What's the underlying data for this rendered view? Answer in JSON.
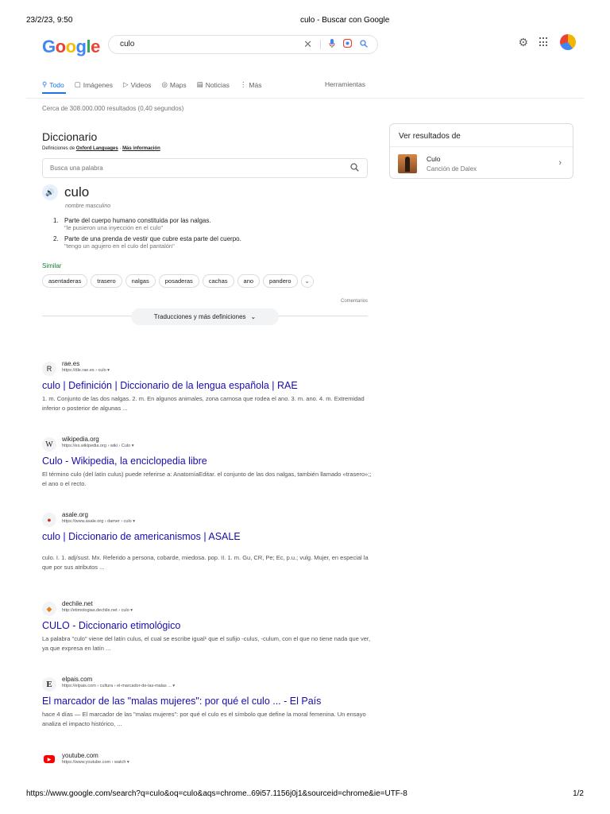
{
  "print": {
    "date": "23/2/23, 9:50",
    "title": "culo - Buscar con Google",
    "url": "https://www.google.com/search?q=culo&oq=culo&aqs=chrome..69i57.1156j0j1&sourceid=chrome&ie=UTF-8",
    "page": "1/2"
  },
  "colors": {
    "link": "#1a0dab",
    "accent": "#1a73e8",
    "similar": "#188038"
  },
  "header": {
    "logo": [
      "G",
      "o",
      "o",
      "g",
      "l",
      "e"
    ],
    "query": "culo",
    "icons": [
      "clear-icon",
      "mic-icon",
      "lens-icon",
      "search-icon",
      "gear-icon",
      "apps-icon",
      "avatar"
    ]
  },
  "tabs": {
    "items": [
      {
        "label": "Todo",
        "icon": "search-icon",
        "active": true
      },
      {
        "label": "Imágenes",
        "icon": "image-icon"
      },
      {
        "label": "Videos",
        "icon": "video-icon"
      },
      {
        "label": "Maps",
        "icon": "pin-icon"
      },
      {
        "label": "Noticias",
        "icon": "news-icon"
      },
      {
        "label": "Más",
        "icon": "more-icon"
      }
    ],
    "tools": "Herramientas"
  },
  "stats": "Cerca de 308.000.000 resultados (0,40 segundos)",
  "dictionary": {
    "title": "Diccionario",
    "sub_prefix": "Definiciones de",
    "sub_link": "Oxford Languages",
    "sub_sep": "·",
    "sub_more": "Más información",
    "search_placeholder": "Busca una palabra",
    "word": "culo",
    "pos": "nombre masculino",
    "definitions": [
      {
        "num": "1.",
        "text": "Parte del cuerpo humano constituida por las nalgas.",
        "example": "\"le pusieron una inyección en el culo\""
      },
      {
        "num": "2.",
        "text": "Parte de una prenda de vestir que cubre esta parte del cuerpo.",
        "example": "\"tengo un agujero en el culo del pantalón\""
      }
    ],
    "similar_label": "Similar",
    "similar": [
      "asentaderas",
      "trasero",
      "nalgas",
      "posaderas",
      "cachas",
      "ano",
      "pandero"
    ],
    "comments": "Comentarios",
    "translations_button": "Traducciones y más definiciones"
  },
  "panel": {
    "title": "Ver resultados de",
    "name": "Culo",
    "sub": "Canción de Dalex"
  },
  "results": [
    {
      "site": "rae.es",
      "url": "https://dle.rae.es › culo ▾",
      "title": "culo | Definición | Diccionario de la lengua española | RAE",
      "snippet": "1. m. Conjunto de las dos nalgas. 2. m. En algunos animales, zona carnosa que rodea el ano. 3. m. ano. 4. m. Extremidad inferior o posterior de algunas ...",
      "favicon": "R"
    },
    {
      "site": "wikipedia.org",
      "url": "https://es.wikipedia.org › wiki › Culo ▾",
      "title": "Culo - Wikipedia, la enciclopedia libre",
      "snippet": "El término culo (del latín culus) puede referirse a: AnatomíaEditar. el conjunto de las dos nalgas, también llamado «trasero»;; el ano o el recto.",
      "favicon": "W"
    },
    {
      "site": "asale.org",
      "url": "https://www.asale.org › damer › culo ▾",
      "title": "culo | Diccionario de americanismos | ASALE",
      "snippet": "culo. I. 1. adj/sust. Mx. Referido a persona, cobarde, miedosa. pop. II. 1. m. Gu, CR, Pe; Ec, p.u.; vulg. Mujer, en especial la que por sus atributos ...",
      "favicon": "●"
    },
    {
      "site": "dechile.net",
      "url": "http://etimologias.dechile.net › culo ▾",
      "title": "CULO - Diccionario etimológico",
      "snippet": "La palabra \"culo\" viene del latín culus, el cual se escribe igual¹ que el sufijo -culus, -culum, con el que no tiene nada que ver, ya que expresa en latín ...",
      "favicon": "◆"
    },
    {
      "site": "elpais.com",
      "url": "https://elpais.com › cultura › el-marcador-de-las-malas ... ▾",
      "title": "El marcador de las \"malas mujeres\": por qué el culo ... - El País",
      "snippet": "hace 4 días — El marcador de las \"malas mujeres\": por qué el culo es el símbolo que define la moral femenina. Un ensayo analiza el impacto histórico, ...",
      "favicon": "E"
    },
    {
      "site": "youtube.com",
      "url": "https://www.youtube.com › watch ▾",
      "title": "",
      "snippet": "",
      "favicon": "▶"
    }
  ]
}
